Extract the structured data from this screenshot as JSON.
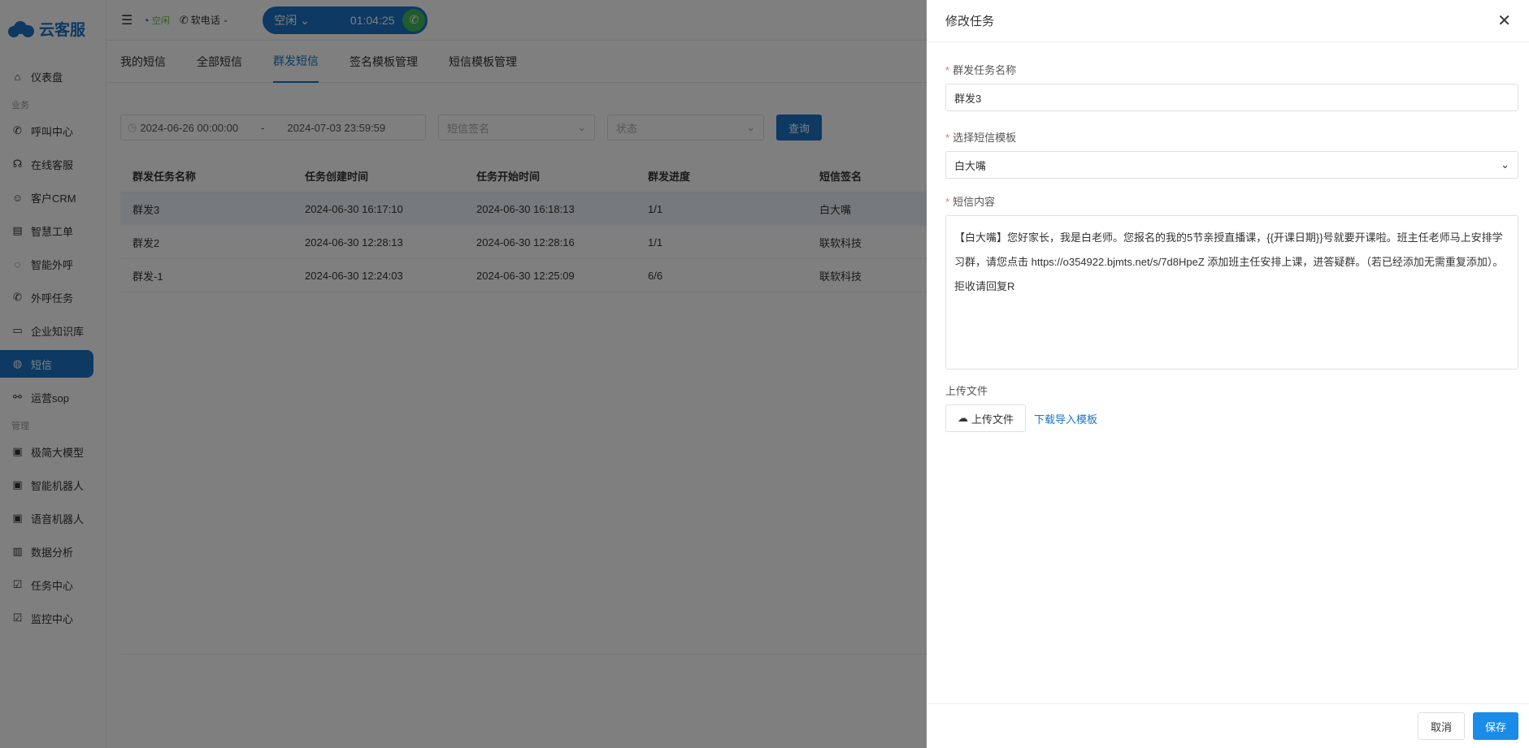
{
  "app": {
    "name": "云客服"
  },
  "sidebar": {
    "items": [
      {
        "label": "仪表盘",
        "icon": "home-icon"
      },
      {
        "group": "业务"
      },
      {
        "label": "呼叫中心",
        "icon": "phone-icon"
      },
      {
        "label": "在线客服",
        "icon": "headset-icon"
      },
      {
        "label": "客户CRM",
        "icon": "user-icon"
      },
      {
        "label": "智慧工单",
        "icon": "document-icon"
      },
      {
        "label": "智能外呼",
        "icon": "whatsapp-icon"
      },
      {
        "label": "外呼任务",
        "icon": "phone-out-icon"
      },
      {
        "label": "企业知识库",
        "icon": "book-icon"
      },
      {
        "label": "短信",
        "icon": "message-icon",
        "active": true
      },
      {
        "label": "运营sop",
        "icon": "share-icon"
      },
      {
        "group": "管理"
      },
      {
        "label": "极简大模型",
        "icon": "robot-icon"
      },
      {
        "label": "智能机器人",
        "icon": "robot-icon"
      },
      {
        "label": "语音机器人",
        "icon": "robot-icon"
      },
      {
        "label": "数据分析",
        "icon": "chart-icon"
      },
      {
        "label": "任务中心",
        "icon": "checkbox-icon"
      },
      {
        "label": "监控中心",
        "icon": "checkbox-icon"
      }
    ]
  },
  "topbar": {
    "status": "空闲",
    "phone_mode": "软电话",
    "call_status": "空闲",
    "timer": "01:04:25"
  },
  "tabs": [
    "我的短信",
    "全部短信",
    "群发短信",
    "签名模板管理",
    "短信模板管理"
  ],
  "filters": {
    "start": "2024-06-26 00:00:00",
    "sep": "-",
    "end": "2024-07-03 23:59:59",
    "signature_placeholder": "短信签名",
    "status_placeholder": "状态",
    "query_button": "查询"
  },
  "table": {
    "headers": [
      "群发任务名称",
      "任务创建时间",
      "任务开始时间",
      "群发进度",
      "短信签名"
    ],
    "rows": [
      [
        "群发3",
        "2024-06-30 16:17:10",
        "2024-06-30 16:18:13",
        "1/1",
        "白大嘴"
      ],
      [
        "群发2",
        "2024-06-30 12:28:13",
        "2024-06-30 12:28:16",
        "1/1",
        "联软科技"
      ],
      [
        "群发-1",
        "2024-06-30 12:24:03",
        "2024-06-30 12:25:09",
        "6/6",
        "联软科技"
      ]
    ]
  },
  "drawer": {
    "title": "修改任务",
    "name_label": "群发任务名称",
    "name_value": "群发3",
    "template_label": "选择短信模板",
    "template_value": "白大嘴",
    "content_label": "短信内容",
    "content_value": "【白大嘴】您好家长，我是白老师。您报名的我的5节亲授直播课，{{开课日期}}号就要开课啦。班主任老师马上安排学习群，请您点击 https://o354922.bjmts.net/s/7d8HpeZ 添加班主任安排上课，进答疑群。（若已经添加无需重复添加）。拒收请回复R",
    "upload_label": "上传文件",
    "upload_button": "上传文件",
    "download_link": "下载导入模板",
    "cancel": "取消",
    "save": "保存"
  }
}
